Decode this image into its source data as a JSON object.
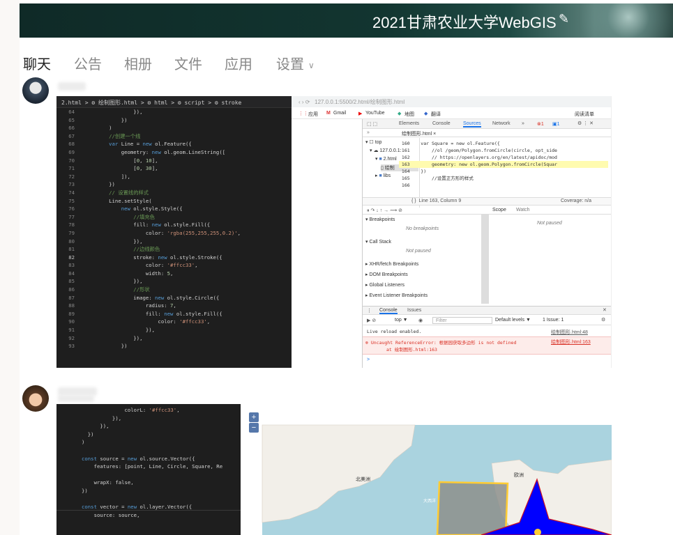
{
  "banner": {
    "title": "2021甘肃农业大学WebGIS",
    "edit_icon": "pencil-icon"
  },
  "tabs": [
    {
      "label": "聊天"
    },
    {
      "label": "公告"
    },
    {
      "label": "相册"
    },
    {
      "label": "文件"
    },
    {
      "label": "应用"
    },
    {
      "label": "设置"
    }
  ],
  "colors": {
    "banner": "#123530",
    "accent": "#ffcc33",
    "map_water": "#aad3df",
    "map_land": "#f2efe9",
    "star": "#0000ff"
  },
  "shot1": {
    "breadcrumb": "2.html > ⚙ 绘制图形.html > ⚙ html > ⚙ script > ⚙ stroke",
    "code": [
      {
        "n": "64",
        "t": "                }),"
      },
      {
        "n": "65",
        "t": "            })"
      },
      {
        "n": "66",
        "t": "        )"
      },
      {
        "n": "67",
        "t": "        //创建一个线"
      },
      {
        "n": "68",
        "t": "        var Line = new ol.Feature({"
      },
      {
        "n": "69",
        "t": "            geometry: new ol.geom.LineString(["
      },
      {
        "n": "70",
        "t": "                [0, 10],"
      },
      {
        "n": "71",
        "t": "                [0, 30],"
      },
      {
        "n": "72",
        "t": "            ]),"
      },
      {
        "n": "73",
        "t": "        })"
      },
      {
        "n": "74",
        "t": "        // 设置线的样式"
      },
      {
        "n": "75",
        "t": "        Line.setStyle("
      },
      {
        "n": "76",
        "t": "            new ol.style.Style({"
      },
      {
        "n": "77",
        "t": "                //填充色"
      },
      {
        "n": "78",
        "t": "                fill: new ol.style.Fill({"
      },
      {
        "n": "79",
        "t": "                    color: 'rgba(255,255,255,0.2)',"
      },
      {
        "n": "80",
        "t": "                }),"
      },
      {
        "n": "81",
        "t": "                //边线颜色"
      },
      {
        "n": "82",
        "t": "                stroke: new ol.style.Stroke({"
      },
      {
        "n": "83",
        "t": "                    color: '#ffcc33',"
      },
      {
        "n": "84",
        "t": "                    width: 5,"
      },
      {
        "n": "85",
        "t": "                }),"
      },
      {
        "n": "86",
        "t": "                //形状"
      },
      {
        "n": "87",
        "t": "                image: new ol.style.Circle({"
      },
      {
        "n": "88",
        "t": "                    radius: 7,"
      },
      {
        "n": "89",
        "t": "                    fill: new ol.style.Fill({"
      },
      {
        "n": "90",
        "t": "                        color: '#ffcc33',"
      },
      {
        "n": "91",
        "t": "                    }),"
      },
      {
        "n": "92",
        "t": "                }),"
      },
      {
        "n": "93",
        "t": "            })"
      }
    ],
    "browser": {
      "address": "127.0.0.1:5500/2.html/绘制图形.html",
      "bookmarks": [
        "应用",
        "Gmail",
        "YouTube",
        "地图",
        "翻译"
      ],
      "reading_list": "阅读清单",
      "devtabs": [
        "Elements",
        "Console",
        "Sources",
        "Network",
        "»"
      ],
      "badges": {
        "errors": "1",
        "messages": "1"
      },
      "file_tab": "绘制图形.html ×",
      "tree": [
        "top",
        "127.0.0.1:",
        "2.html",
        "绘制",
        "libs"
      ],
      "src_lines": [
        {
          "n": "160",
          "t": "  var Square = new ol.Feature({"
        },
        {
          "n": "161",
          "t": "      //ol /geom/Polygon.fromCircle(circle, opt_side"
        },
        {
          "n": "162",
          "t": "      // https://openlayers.org/en/latest/apidoc/mod"
        },
        {
          "n": "163",
          "t": "      geometry: new ol.geom.Polygon.fromCircle(Squar"
        },
        {
          "n": "164",
          "t": "  })"
        },
        {
          "n": "165",
          "t": "      //设置正方形的样式"
        },
        {
          "n": "166",
          "t": ""
        }
      ],
      "status": "Line 163, Column 9",
      "coverage": "Coverage: n/a",
      "scope_tabs": [
        "Scope",
        "Watch"
      ],
      "not_paused": "Not paused",
      "panels": [
        {
          "title": "Breakpoints",
          "body": "No breakpoints"
        },
        {
          "title": "Call Stack",
          "body": "Not paused"
        },
        {
          "title": "XHR/fetch Breakpoints",
          "body": ""
        },
        {
          "title": "DOM Breakpoints",
          "body": ""
        },
        {
          "title": "Global Listeners",
          "body": ""
        },
        {
          "title": "Event Listener Breakpoints",
          "body": ""
        }
      ],
      "console_tabs": [
        "Console",
        "Issues"
      ],
      "filter_placeholder": "Filter",
      "context": "top ▼",
      "levels": "Default levels ▼",
      "issues": "1 Issue: 1",
      "log1": "Live reload enabled.",
      "log1_src": "绘制图形.html:48",
      "err1": "Uncaught ReferenceError: 根据园获取多边形 is not defined",
      "err1_src": "绘制图形.html:163",
      "err2": "at 绘制图形.html:163",
      "prompt": ">"
    }
  },
  "shot2": {
    "code": [
      "              colorL: '#ffcc33',",
      "          }),",
      "      }),",
      "  })",
      ")",
      "",
      "const source = new ol.source.Vector({",
      "    features: [point, Line, Circle, Square, Re",
      "",
      "    wrapX: false,",
      "})",
      "",
      "const vector = new ol.layer.Vector({",
      "    source: source,"
    ],
    "zoom_in": "+",
    "zoom_out": "−",
    "labels": [
      "北美洲",
      "欧洲",
      "大西洋"
    ]
  }
}
